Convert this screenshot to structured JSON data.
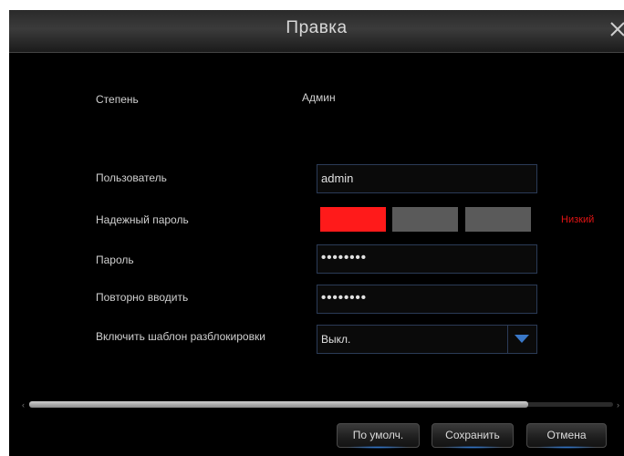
{
  "dialog": {
    "title": "Правка"
  },
  "form": {
    "level_label": "Степень",
    "level_value": "Админ",
    "user_label": "Пользователь",
    "user_value": "admin",
    "strength_label": "Надежный пароль",
    "strength_text": "Низкий",
    "strength_level": 1,
    "strength_max": 3,
    "password_label": "Пароль",
    "password_value": "••••••••",
    "confirm_label": "Повторно вводить",
    "confirm_value": "••••••••",
    "unlock_label": "Включить шаблон разблокировки",
    "unlock_value": "Выкл."
  },
  "scroll": {
    "position_fraction": 0.85
  },
  "buttons": {
    "default_label": "По умолч.",
    "save_label": "Сохранить",
    "cancel_label": "Отмена"
  },
  "colors": {
    "strength_active": "#ff1a1a",
    "strength_inactive": "#5a5a5a",
    "strength_text": "#e11414",
    "accent": "#2f7bd8"
  }
}
